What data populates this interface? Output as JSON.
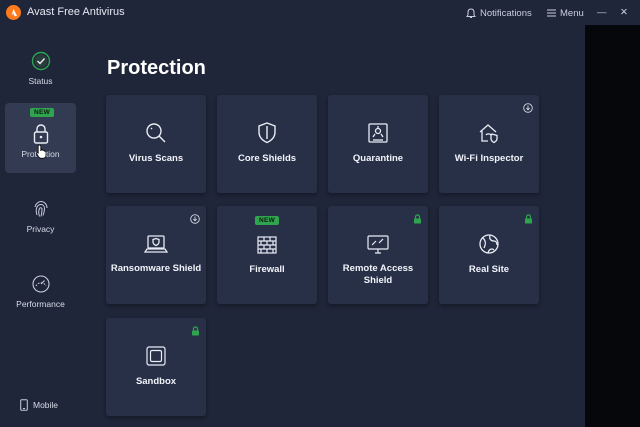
{
  "app": {
    "title": "Avast Free Antivirus"
  },
  "titlebar": {
    "notifications": "Notifications",
    "menu": "Menu",
    "minimize": "—",
    "close": "✕"
  },
  "sidebar": {
    "items": [
      {
        "label": "Status",
        "icon": "check-circle-icon"
      },
      {
        "label": "Protection",
        "icon": "lock-icon",
        "badge": "NEW",
        "active": true
      },
      {
        "label": "Privacy",
        "icon": "fingerprint-icon"
      },
      {
        "label": "Performance",
        "icon": "speedometer-icon"
      }
    ],
    "mobile": "Mobile"
  },
  "main": {
    "title": "Protection",
    "tiles": [
      {
        "label": "Virus Scans",
        "icon": "magnifier-icon"
      },
      {
        "label": "Core Shields",
        "icon": "shield-icon"
      },
      {
        "label": "Quarantine",
        "icon": "biohazard-icon"
      },
      {
        "label": "Wi-Fi Inspector",
        "icon": "home-shield-icon",
        "corner": "download-icon"
      },
      {
        "label": "Ransomware Shield",
        "icon": "laptop-shield-icon",
        "corner": "download-icon"
      },
      {
        "label": "Firewall",
        "icon": "brick-wall-icon",
        "badge": "NEW"
      },
      {
        "label": "Remote Access Shield",
        "icon": "monitor-shield-icon",
        "corner": "lock-icon"
      },
      {
        "label": "Real Site",
        "icon": "globe-icon",
        "corner": "lock-icon"
      },
      {
        "label": "Sandbox",
        "icon": "sandbox-icon",
        "corner": "lock-icon"
      }
    ]
  },
  "colors": {
    "background": "#1f2639",
    "tile": "#283047",
    "active": "#323b52",
    "green": "#2ea44f",
    "orange": "#ff7a1a"
  }
}
